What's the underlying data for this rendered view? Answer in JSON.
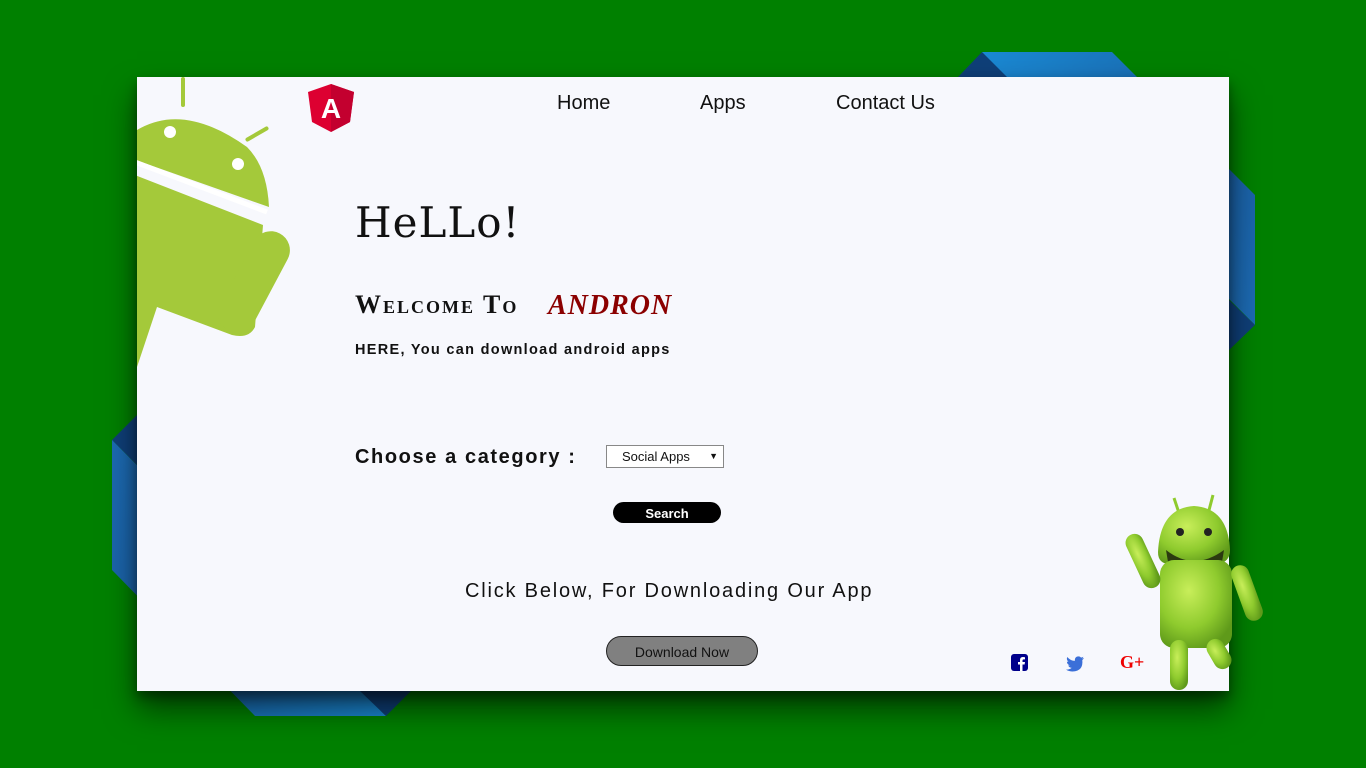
{
  "nav": {
    "home": "Home",
    "apps": "Apps",
    "contact": "Contact Us"
  },
  "logo": {
    "letter": "A",
    "icon": "angular-logo-icon",
    "color": "#dd0031"
  },
  "hero": {
    "greeting": "HeLLo!",
    "welcome": "Welcome To",
    "brand": "ANDRON",
    "subtitle": "HERE, You can download android apps"
  },
  "category": {
    "label": "Choose a category :",
    "selected": "Social Apps"
  },
  "search": {
    "label": "Search"
  },
  "download": {
    "prompt": "Click Below, For Downloading Our App",
    "button": "Download Now"
  },
  "social": {
    "facebook": {
      "icon": "facebook-icon",
      "color": "#00008b"
    },
    "twitter": {
      "icon": "twitter-icon",
      "color": "#3b6fd8"
    },
    "googleplus": {
      "icon": "google-plus-icon",
      "text": "G+",
      "color": "#e00000"
    }
  },
  "colors": {
    "background": "#008000",
    "card": "#f7f8fd",
    "ribbon": "#1a63a8",
    "brand": "#8b0000",
    "android": "#a4c93a"
  }
}
